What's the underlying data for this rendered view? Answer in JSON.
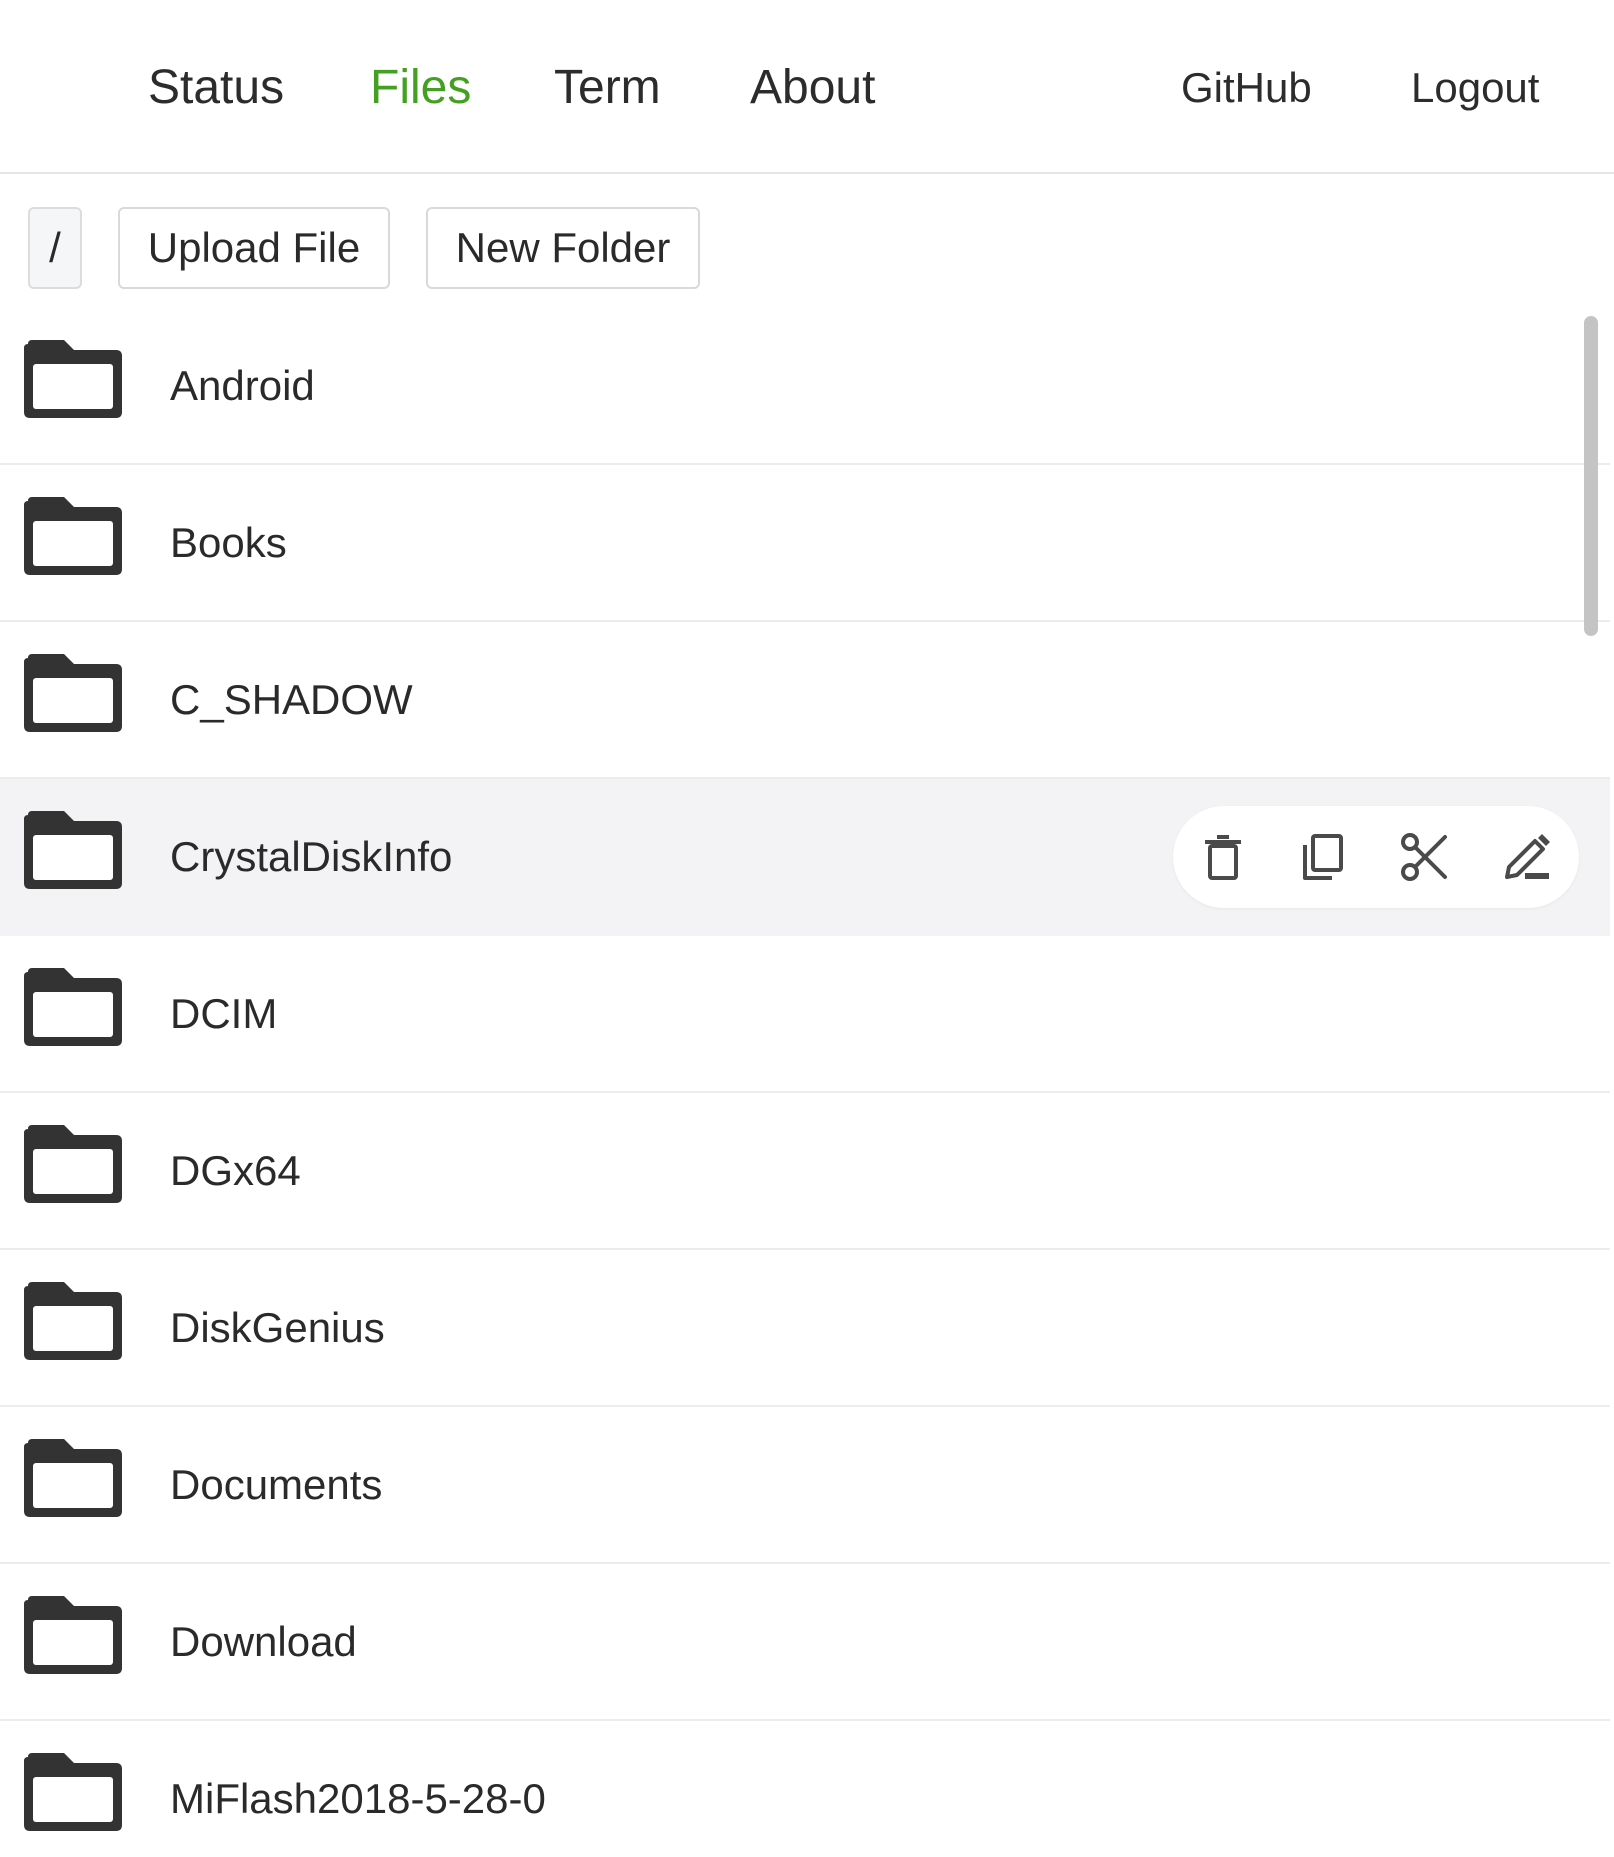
{
  "nav": {
    "status": "Status",
    "files": "Files",
    "term": "Term",
    "about": "About",
    "github": "GitHub",
    "logout": "Logout",
    "active_tab": "Files",
    "active_color": "#44a020"
  },
  "toolbar": {
    "path": "/",
    "upload_label": "Upload File",
    "new_folder_label": "New Folder"
  },
  "files": [
    {
      "name": "Android",
      "type": "folder"
    },
    {
      "name": "Books",
      "type": "folder"
    },
    {
      "name": "C_SHADOW",
      "type": "folder"
    },
    {
      "name": "CrystalDiskInfo",
      "type": "folder",
      "hovered": true
    },
    {
      "name": "DCIM",
      "type": "folder"
    },
    {
      "name": "DGx64",
      "type": "folder"
    },
    {
      "name": "DiskGenius",
      "type": "folder"
    },
    {
      "name": "Documents",
      "type": "folder"
    },
    {
      "name": "Download",
      "type": "folder"
    },
    {
      "name": "MiFlash2018-5-28-0",
      "type": "folder"
    }
  ],
  "row_actions": [
    "delete-icon",
    "copy-icon",
    "cut-icon",
    "rename-icon"
  ]
}
